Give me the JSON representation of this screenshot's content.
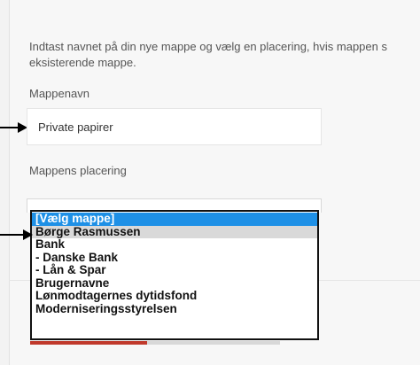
{
  "dialog": {
    "intro_line1": "Indtast navnet på din nye mappe og vælg en placering, hvis mappen s",
    "intro_line2": "eksisterende mappe.",
    "folder_name_label": "Mappenavn",
    "folder_name_value": "Private papirer",
    "placement_label": "Mappens placering"
  },
  "dropdown": {
    "options": [
      "[Vælg mappe]",
      "Børge Rasmussen",
      "Bank",
      "- Danske Bank",
      "- Lån & Spar",
      "Brugernavne",
      "Lønmodtagernes dytidsfond",
      "Moderniseringsstyrelsen"
    ],
    "selected_index": 0,
    "hover_index": 1
  },
  "colors": {
    "selected_bg": "#1e90e6",
    "hover_bg": "#d9d9d9",
    "button_accent": "#c0392b"
  },
  "icons": [
    "arrow-right-icon",
    "arrow-right-icon"
  ]
}
